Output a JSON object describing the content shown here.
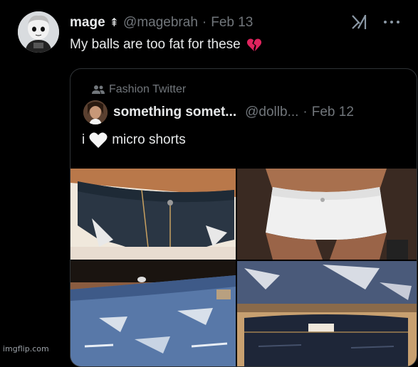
{
  "tweet": {
    "author_name": "mage",
    "author_badge": "⇞",
    "handle": "@magebrah",
    "separator": "·",
    "date": "Feb 13",
    "text": "My balls are too fat for these",
    "emoji": "broken-heart-icon",
    "avatar": "avatar-character"
  },
  "icons": {
    "grok": "grok-icon",
    "more": "more-options-icon"
  },
  "quote": {
    "community_label": "Fashion Twitter",
    "author_name": "something somet...",
    "handle": "@dollb...",
    "separator": "·",
    "date": "Feb 12",
    "text_before": "i",
    "text_after": "micro shorts",
    "heart_icon": "white-heart-icon",
    "images": [
      {
        "name": "dark-denim-shorts-photo"
      },
      {
        "name": "white-denim-shorts-photo"
      },
      {
        "name": "distressed-blue-shorts-photo"
      },
      {
        "name": "folded-shorts-photo"
      }
    ]
  },
  "watermark": "imgflip.com",
  "colors": {
    "background": "#000000",
    "text": "#e7e9ea",
    "muted": "#71767b",
    "border": "#2f3336",
    "broken_heart": "#e0245e"
  }
}
